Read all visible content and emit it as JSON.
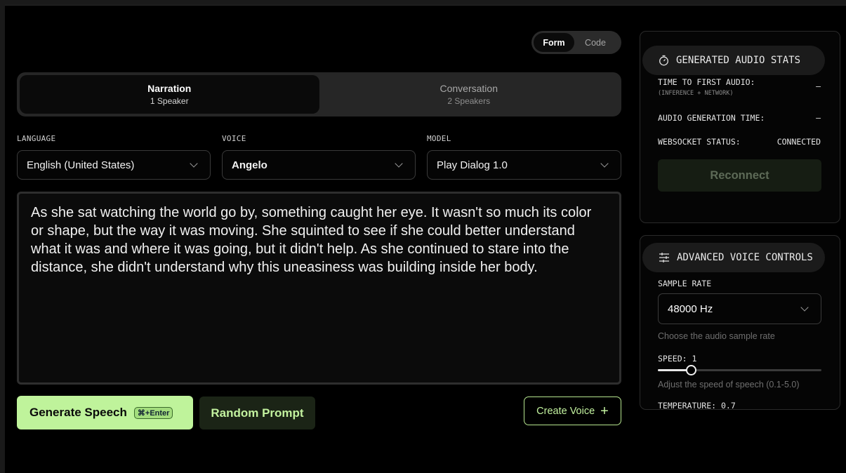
{
  "mode_toggle": {
    "form": "Form",
    "code": "Code"
  },
  "speaker_tabs": [
    {
      "title": "Narration",
      "subtitle": "1 Speaker",
      "active": true
    },
    {
      "title": "Conversation",
      "subtitle": "2 Speakers",
      "active": false
    }
  ],
  "language": {
    "label": "LANGUAGE",
    "value": "English (United States)"
  },
  "voice": {
    "label": "VOICE",
    "value": "Angelo"
  },
  "model": {
    "label": "MODEL",
    "value": "Play Dialog 1.0"
  },
  "prompt_text": "As she sat watching the world go by, something caught her eye. It wasn't so much its color or shape, but the way it was moving. She squinted to see if she could better understand what it was and where it was going, but it didn't help. As she continued to stare into the distance, she didn't understand why this uneasiness was building inside her body.",
  "actions": {
    "generate": "Generate Speech",
    "generate_shortcut": "⌘+Enter",
    "random": "Random Prompt",
    "create_voice": "Create Voice",
    "create_voice_icon": "plus-icon"
  },
  "stats": {
    "title": "GENERATED AUDIO STATS",
    "icon": "stopwatch-icon",
    "time_to_first_label": "TIME TO FIRST AUDIO:",
    "time_to_first_sub": "(INFERENCE + NETWORK)",
    "time_to_first_value": "–",
    "generation_label": "AUDIO GENERATION TIME:",
    "generation_value": "–",
    "ws_label": "WEBSOCKET STATUS:",
    "ws_value": "CONNECTED",
    "reconnect": "Reconnect"
  },
  "advanced": {
    "title": "ADVANCED VOICE CONTROLS",
    "icon": "sliders-icon",
    "sample_rate_label": "SAMPLE RATE",
    "sample_rate_value": "48000 Hz",
    "sample_rate_hint": "Choose the audio sample rate",
    "speed_label": "SPEED: 1",
    "speed_value": 1,
    "speed_min": 0.1,
    "speed_max": 5.0,
    "speed_hint": "Adjust the speed of speech (0.1-5.0)",
    "temperature_label": "TEMPERATURE: 0.7"
  },
  "colors": {
    "accent": "#bff39b",
    "background": "#000000"
  }
}
